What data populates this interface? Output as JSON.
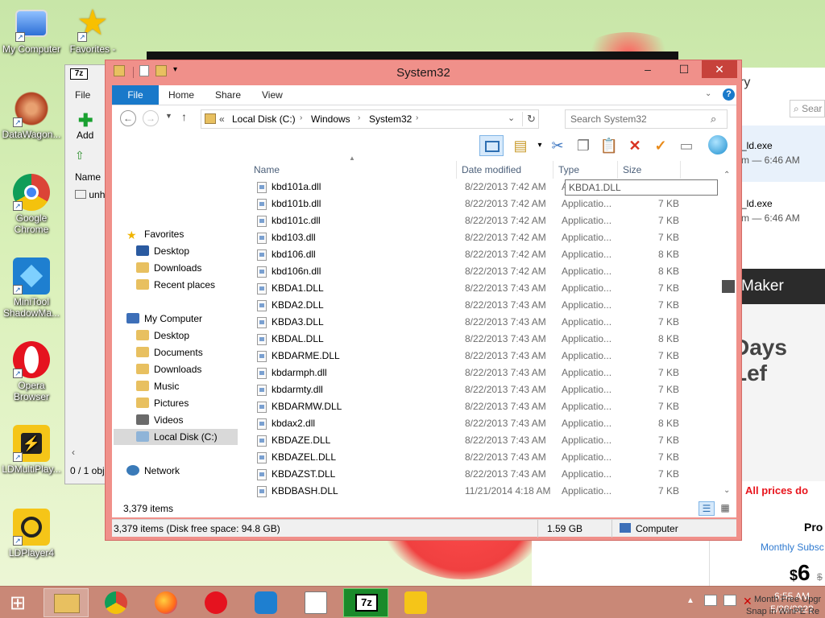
{
  "desktop": {
    "icons": [
      {
        "label": "My Computer",
        "icon": "computer-icon"
      },
      {
        "label": "Favorites -",
        "icon": "star-icon"
      },
      {
        "label": "DataWagon...",
        "icon": "datawagon-icon"
      },
      {
        "label": "Google Chrome",
        "icon": "chrome-icon"
      },
      {
        "label": "MiniTool ShadowMa...",
        "icon": "minitool-icon"
      },
      {
        "label": "Opera Browser",
        "icon": "opera-icon"
      },
      {
        "label": "LDMultiPlay...",
        "icon": "ldmultiplayer-icon"
      },
      {
        "label": "LDPlayer4",
        "icon": "ldplayer-icon"
      }
    ]
  },
  "win7z": {
    "badge": "7z",
    "file_tab": "File",
    "add_label": "Add",
    "name_header": "Name",
    "row": "unh",
    "status": "0 / 1 obj"
  },
  "browser": {
    "partial_title": "ry",
    "search_placeholder": "Sear",
    "downloads": [
      {
        "name": "_ld.exe",
        "sub": "m — 6:46 AM"
      },
      {
        "name": "_ld.exe",
        "sub": "m — 6:46 AM"
      }
    ],
    "banner": "Maker",
    "days_left": "Days Lef",
    "prices_note": "All prices do NOT",
    "plan": "Pro",
    "plan_sub": "Monthly Subsc",
    "price": "6",
    "currency": "$",
    "strike_price": "$",
    "promo": "Month Free Upgr",
    "promo2": "Snap in WinPE Re"
  },
  "explorer": {
    "title": "System32",
    "ribbon_tabs": [
      "File",
      "Home",
      "Share",
      "View"
    ],
    "breadcrumb": [
      "Local Disk (C:)",
      "Windows",
      "System32"
    ],
    "breadcrumb_prefix": "«",
    "search_placeholder": "Search System32",
    "nav": {
      "favorites": "Favorites",
      "favorites_items": [
        "Desktop",
        "Downloads",
        "Recent places"
      ],
      "computer": "My Computer",
      "computer_items": [
        "Desktop",
        "Documents",
        "Downloads",
        "Music",
        "Pictures",
        "Videos",
        "Local Disk (C:)"
      ],
      "network": "Network"
    },
    "columns": [
      "Name",
      "Date modified",
      "Type",
      "Size"
    ],
    "rows": [
      {
        "name": "kbd101a.dll",
        "date": "8/22/2013 7:42 AM",
        "type": "Applicatio...",
        "size": ""
      },
      {
        "name": "kbd101b.dll",
        "date": "8/22/2013 7:42 AM",
        "type": "Applicatio...",
        "size": "7 KB"
      },
      {
        "name": "kbd101c.dll",
        "date": "8/22/2013 7:42 AM",
        "type": "Applicatio...",
        "size": "7 KB"
      },
      {
        "name": "kbd103.dll",
        "date": "8/22/2013 7:42 AM",
        "type": "Applicatio...",
        "size": "7 KB"
      },
      {
        "name": "kbd106.dll",
        "date": "8/22/2013 7:42 AM",
        "type": "Applicatio...",
        "size": "8 KB"
      },
      {
        "name": "kbd106n.dll",
        "date": "8/22/2013 7:42 AM",
        "type": "Applicatio...",
        "size": "8 KB"
      },
      {
        "name": "KBDA1.DLL",
        "date": "8/22/2013 7:43 AM",
        "type": "Applicatio...",
        "size": "7 KB"
      },
      {
        "name": "KBDA2.DLL",
        "date": "8/22/2013 7:43 AM",
        "type": "Applicatio...",
        "size": "7 KB"
      },
      {
        "name": "KBDA3.DLL",
        "date": "8/22/2013 7:43 AM",
        "type": "Applicatio...",
        "size": "7 KB"
      },
      {
        "name": "KBDAL.DLL",
        "date": "8/22/2013 7:43 AM",
        "type": "Applicatio...",
        "size": "8 KB"
      },
      {
        "name": "KBDARME.DLL",
        "date": "8/22/2013 7:43 AM",
        "type": "Applicatio...",
        "size": "7 KB"
      },
      {
        "name": "kbdarmph.dll",
        "date": "8/22/2013 7:43 AM",
        "type": "Applicatio...",
        "size": "7 KB"
      },
      {
        "name": "kbdarmty.dll",
        "date": "8/22/2013 7:43 AM",
        "type": "Applicatio...",
        "size": "7 KB"
      },
      {
        "name": "KBDARMW.DLL",
        "date": "8/22/2013 7:43 AM",
        "type": "Applicatio...",
        "size": "7 KB"
      },
      {
        "name": "kbdax2.dll",
        "date": "8/22/2013 7:43 AM",
        "type": "Applicatio...",
        "size": "8 KB"
      },
      {
        "name": "KBDAZE.DLL",
        "date": "8/22/2013 7:43 AM",
        "type": "Applicatio...",
        "size": "7 KB"
      },
      {
        "name": "KBDAZEL.DLL",
        "date": "8/22/2013 7:43 AM",
        "type": "Applicatio...",
        "size": "7 KB"
      },
      {
        "name": "KBDAZST.DLL",
        "date": "8/22/2013 7:43 AM",
        "type": "Applicatio...",
        "size": "7 KB"
      },
      {
        "name": "KBDBASH.DLL",
        "date": "11/21/2014 4:18 AM",
        "type": "Applicatio...",
        "size": "7 KB"
      }
    ],
    "tooltip": "KBDA1.DLL",
    "item_count": "3,379 items",
    "status_left": "3,379 items (Disk free space: 94.8 GB)",
    "status_size": "1.59 GB",
    "status_location": "Computer"
  },
  "taskbar": {
    "apps": [
      "start-icon",
      "file-explorer-icon",
      "chrome-icon",
      "firefox-icon",
      "opera-icon",
      "minitool-icon",
      "notepad-icon",
      "7zip-icon",
      "ldplayer-icon"
    ],
    "time": "6:55 AM",
    "date": "5/28/2022"
  },
  "colors": {
    "accent": "#1979ca",
    "window_frame": "#f0908a",
    "taskbar": "#c98877"
  }
}
